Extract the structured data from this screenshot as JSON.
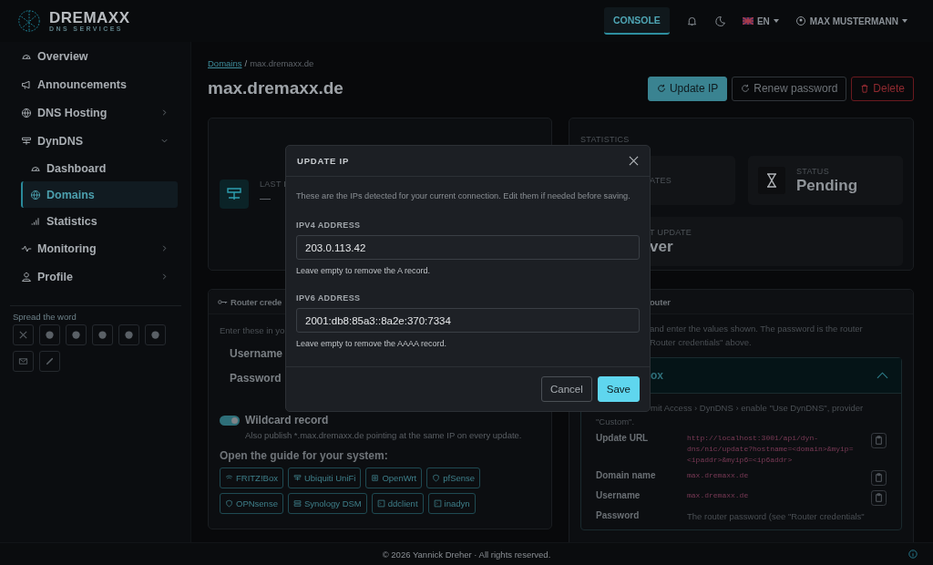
{
  "brand": {
    "name": "DREMAXX",
    "tagline": "DNS SERVICES"
  },
  "topbar": {
    "console": {
      "label": "CONSOLE",
      "selected": true
    },
    "language": "EN",
    "user": "MAX MUSTERMANN"
  },
  "sidebar": {
    "items": [
      {
        "label": "Overview",
        "kind": "link",
        "selected": false
      },
      {
        "label": "Announcements",
        "kind": "link",
        "selected": false
      },
      {
        "label": "DNS Hosting",
        "kind": "group",
        "expanded": false,
        "selected": false
      },
      {
        "label": "DynDNS",
        "kind": "group",
        "expanded": true,
        "selected": false,
        "children": [
          {
            "label": "Dashboard",
            "selected": false
          },
          {
            "label": "Domains",
            "selected": true
          },
          {
            "label": "Statistics",
            "selected": false
          }
        ]
      },
      {
        "label": "Monitoring",
        "kind": "group",
        "expanded": false,
        "selected": false
      },
      {
        "label": "Profile",
        "kind": "group",
        "expanded": false,
        "selected": false
      }
    ],
    "share_title": "Spread the word"
  },
  "breadcrumb": {
    "link": "Domains",
    "separator": "/",
    "current": "max.dremaxx.de"
  },
  "title": "max.dremaxx.de",
  "actions": [
    {
      "label": "Update IP",
      "kind": "primary"
    },
    {
      "label": "Renew password",
      "kind": "outline"
    },
    {
      "label": "Delete",
      "kind": "danger"
    }
  ],
  "ip_card": {
    "label": "LAST I",
    "value": "—"
  },
  "statistics": {
    "title": "STATISTICS",
    "tiles": [
      {
        "kind": "covered",
        "label": "ATES"
      },
      {
        "kind": "icon",
        "label": "STATUS",
        "value": "Pending"
      },
      {
        "kind": "covered",
        "label": "T UPDATE",
        "value": "ver"
      }
    ]
  },
  "credentials": {
    "title": "Router crede",
    "intro": "Enter these in yo",
    "fields": [
      "Username",
      "Password"
    ],
    "wildcard": {
      "label": "Wildcard record",
      "on": true,
      "hint": "Also publish *.max.dremaxx.de pointing at the same IP on every update."
    },
    "guides_title": "Open the guide for your system:",
    "guides": [
      "FRITZ!Box",
      "Ubiquiti UniFi",
      "OpenWrt",
      "pfSense",
      "OPNsense",
      "Synology DSM",
      "ddclient",
      "inadyn"
    ]
  },
  "setup": {
    "title": "outer",
    "intro_lines": [
      "and enter the values shown. The password is the router",
      "Router credentials\" above."
    ],
    "accordion": {
      "title": "ox",
      "expanded": true,
      "note": "mit Access › DynDNS › enable \"Use DynDNS\", provider \"Custom\".",
      "rows": [
        {
          "label": "Update URL",
          "kind": "code",
          "value": "http://localhost:3001/api/dyn-dns/nic/update?hostname=<domain>&myip=<ipaddr>&myip6=<ip6addr>"
        },
        {
          "label": "Domain name",
          "kind": "code",
          "value": "max.dremaxx.de"
        },
        {
          "label": "Username",
          "kind": "code",
          "value": "max.dremaxx.de"
        },
        {
          "label": "Password",
          "kind": "text",
          "value": "The router password (see \"Router credentials\""
        }
      ]
    }
  },
  "modal": {
    "title": "UPDATE IP",
    "intro": "These are the IPs detected for your current connection. Edit them if needed before saving.",
    "fields": [
      {
        "label": "IPV4 ADDRESS",
        "value": "203.0.113.42",
        "hint": "Leave empty to remove the A record."
      },
      {
        "label": "IPV6 ADDRESS",
        "value": "2001:db8:85a3::8a2e:370:7334",
        "hint": "Leave empty to remove the AAAA record."
      }
    ],
    "buttons": [
      {
        "label": "Cancel",
        "kind": "secondary"
      },
      {
        "label": "Save",
        "kind": "primary"
      }
    ]
  },
  "footer": "© 2026 Yannick Dreher · All rights reserved."
}
